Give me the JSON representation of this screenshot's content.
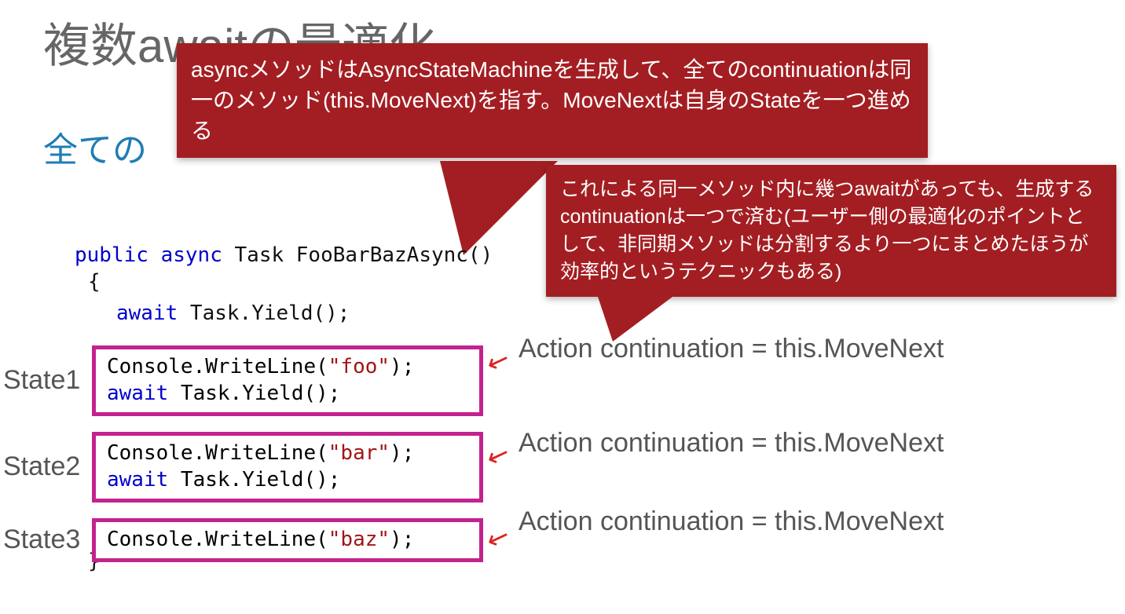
{
  "title": "複数awaitの最適化",
  "subtitle": "全ての",
  "callout1": "asyncメソッドはAsyncStateMachineを生成して、全てのcontinuationは同一のメソッド(this.MoveNext)を指す。MoveNextは自身のStateを一つ進める",
  "callout2": "これによる同一メソッド内に幾つawaitがあっても、生成するcontinuationは一つで済む(ユーザー側の最適化のポイントとして、非同期メソッドは分割するより一つにまとめたほうが効率的というテクニックもある)",
  "code": {
    "kw_public": "public",
    "kw_async": "async",
    "sig_rest": " Task FooBarBazAsync()",
    "brace_open": "{",
    "brace_close": "}",
    "kw_await": "await",
    "yield_tail": " Task.Yield();",
    "write_head": "Console.WriteLine(",
    "write_tail": ");",
    "str_foo": "\"foo\"",
    "str_bar": "\"bar\"",
    "str_baz": "\"baz\""
  },
  "states": {
    "label1": "State1",
    "label2": "State2",
    "label3": "State3"
  },
  "continuation": "Action continuation = this.MoveNext"
}
